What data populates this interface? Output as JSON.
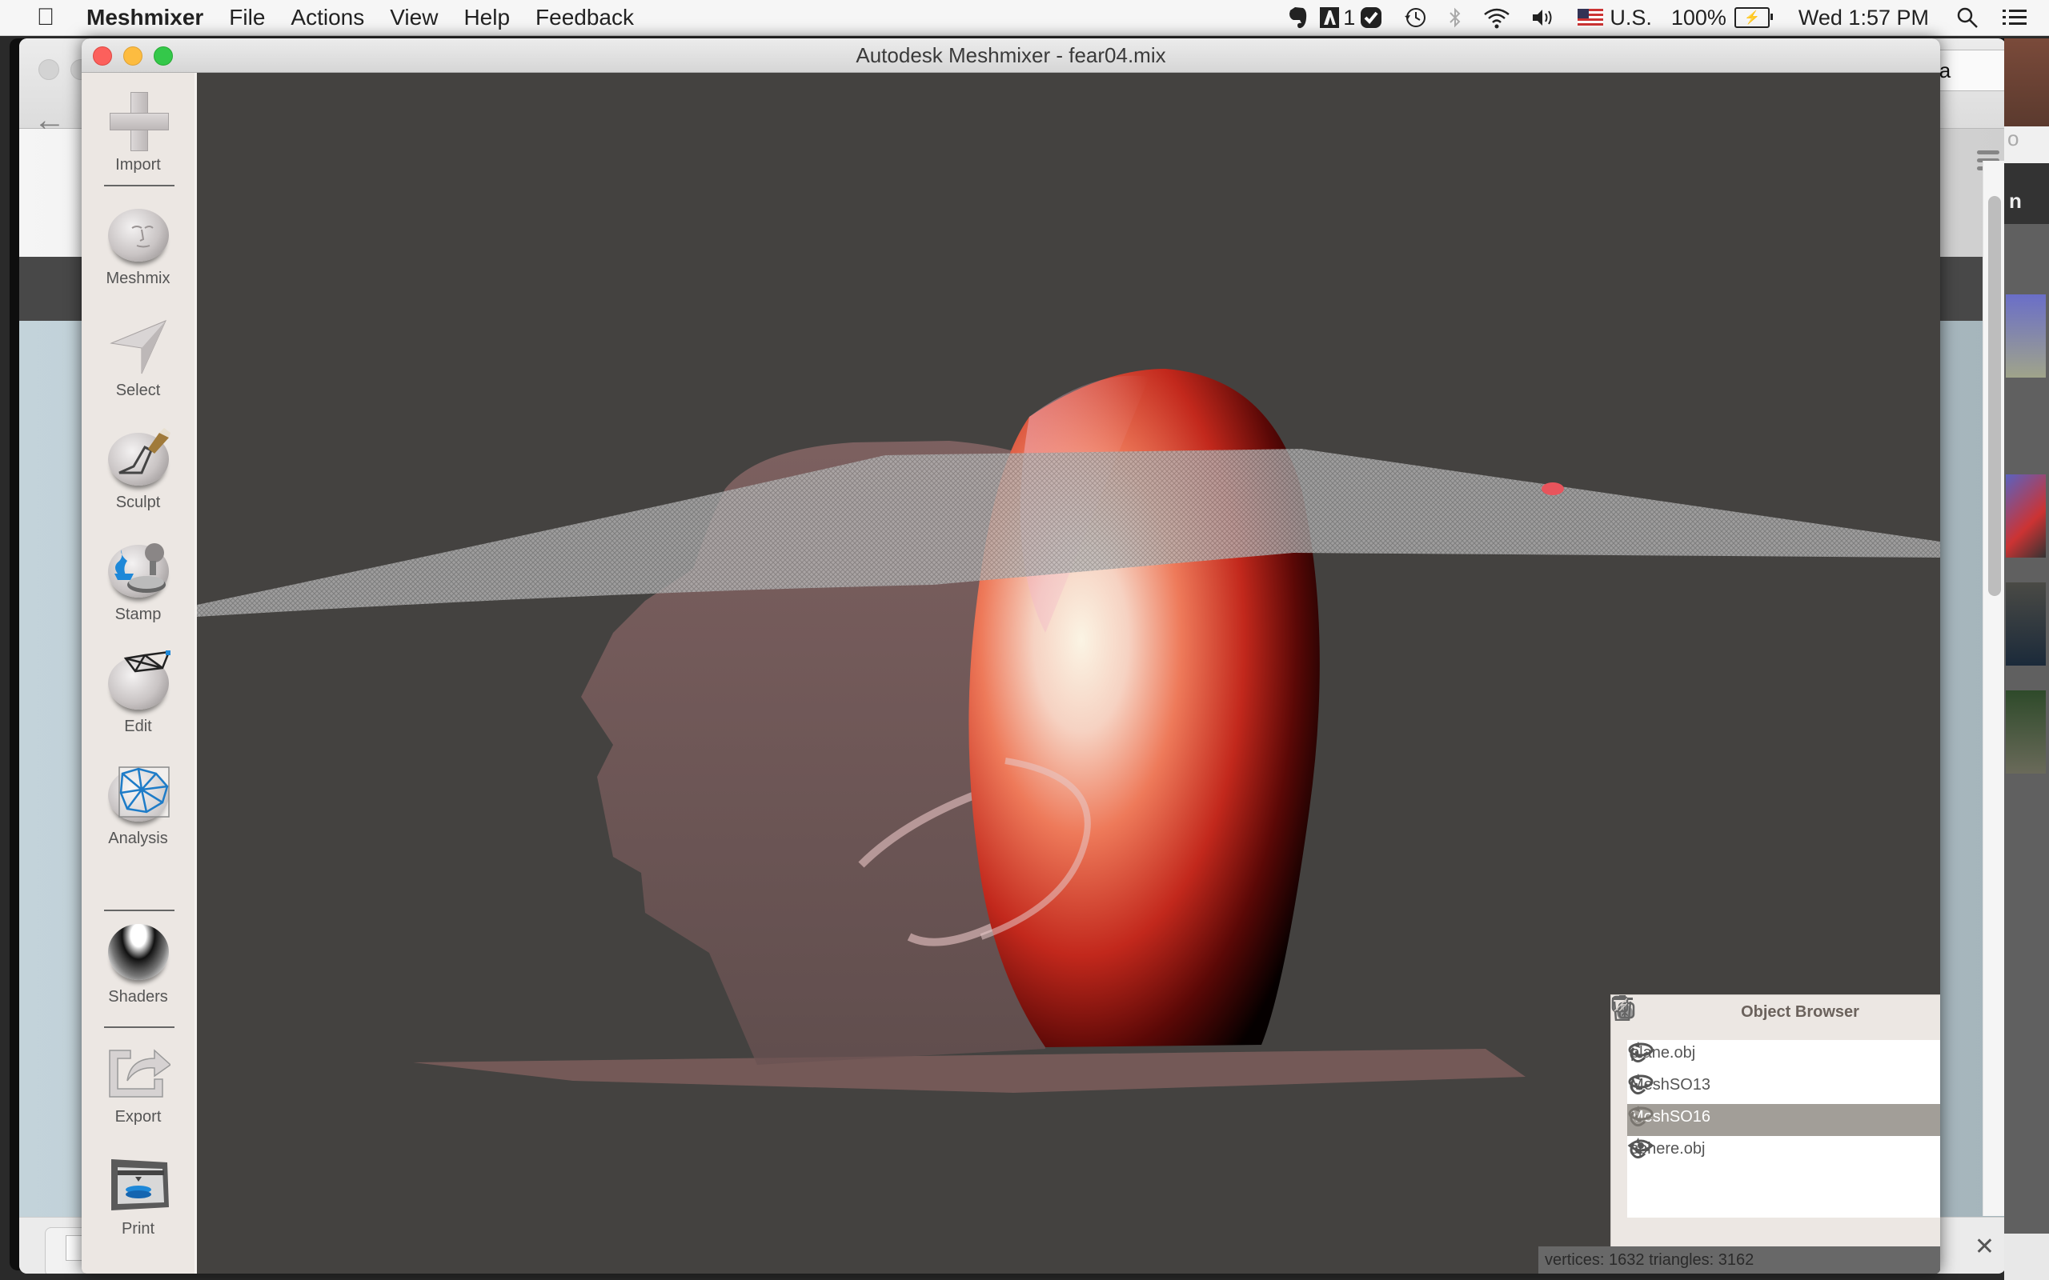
{
  "menubar": {
    "apple_icon": "apple-logo-icon",
    "app_name": "Meshmixer",
    "menus": [
      "File",
      "Actions",
      "View",
      "Help",
      "Feedback"
    ],
    "status_icons": [
      "evernote-icon",
      "adobe-icon",
      "adobe-badge",
      "checkmark-icon",
      "time-machine-icon",
      "bluetooth-icon",
      "wifi-icon",
      "volume-icon",
      "us-flag-icon"
    ],
    "adobe_badge": "1",
    "input_source": "U.S.",
    "battery": "100%",
    "clock": "Wed 1:57 PM"
  },
  "background": {
    "browser_search_text": "naisa",
    "photo_strip_text_top": "o",
    "photo_strip_nav_text": "n"
  },
  "window": {
    "title": "Autodesk Meshmixer - fear04.mix"
  },
  "sidebar": {
    "tools": [
      {
        "label": "Import",
        "icon": "plus-icon"
      },
      {
        "label": "Meshmix",
        "icon": "face-sphere-icon"
      },
      {
        "label": "Select",
        "icon": "arrow-cursor-icon"
      },
      {
        "label": "Sculpt",
        "icon": "sculpt-brush-icon"
      },
      {
        "label": "Stamp",
        "icon": "stamp-icon"
      },
      {
        "label": "Edit",
        "icon": "edit-mesh-icon"
      },
      {
        "label": "Analysis",
        "icon": "analysis-mesh-icon"
      },
      {
        "label": "Shaders",
        "icon": "shader-sphere-icon"
      },
      {
        "label": "Export",
        "icon": "export-arrow-icon"
      },
      {
        "label": "Print",
        "icon": "printer-icon"
      }
    ]
  },
  "viewport": {
    "objects": [
      "transparent head mesh",
      "red egg-shaped solid",
      "gridded plane",
      "small red sphere",
      "ground shadow plane"
    ],
    "colors": {
      "background": "#444240",
      "egg_light": "#f7efe0",
      "egg_mid": "#e0553a",
      "egg_dark": "#5a0a08",
      "head_tint": "#c8a0a0",
      "plane": "#b8b8b8",
      "sphere": "#e8545c"
    }
  },
  "object_browser": {
    "title": "Object Browser",
    "items": [
      {
        "name": "plane.obj",
        "selected": false,
        "visible_icon": "eye-closed-icon"
      },
      {
        "name": "MeshSO13",
        "selected": false,
        "visible_icon": "eye-closed-icon"
      },
      {
        "name": "MeshSO16",
        "selected": true,
        "visible_icon": "eye-closed-icon"
      },
      {
        "name": "sphere.obj",
        "selected": false,
        "visible_icon": "eye-open-icon"
      }
    ],
    "footer_buttons": [
      "duplicate-icon",
      "trash-icon"
    ]
  },
  "statusbar": {
    "text": "vertices: 1632 triangles: 3162"
  }
}
